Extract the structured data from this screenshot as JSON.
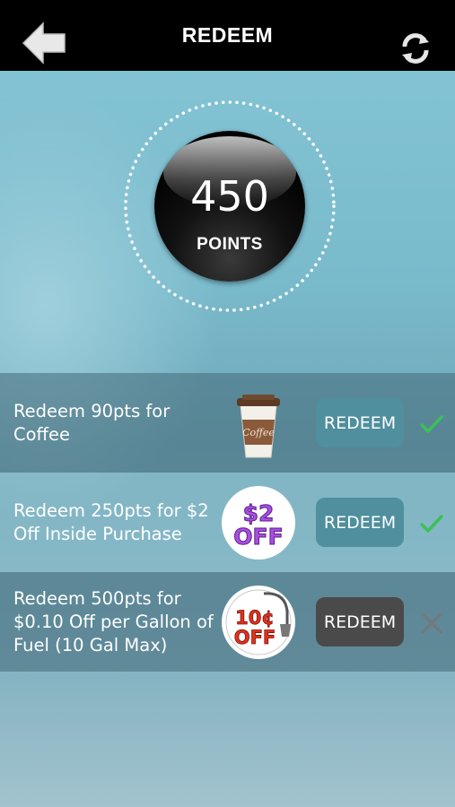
{
  "header": {
    "title": "REDEEM"
  },
  "points": {
    "value": "450",
    "label": "POINTS"
  },
  "rewards": [
    {
      "text": "Redeem 90pts for Coffee",
      "image": "coffee-cup",
      "button_label": "REDEEM",
      "status": "available"
    },
    {
      "text": "Redeem 250pts for $2 Off Inside Purchase",
      "image": "two-dollar-off-badge",
      "badge_line1": "$2",
      "badge_line2": "OFF",
      "button_label": "REDEEM",
      "status": "available"
    },
    {
      "text": "Redeem 500pts for $0.10 Off per Gallon of Fuel (10 Gal Max)",
      "image": "ten-cent-off-fuel-badge",
      "badge_line1": "10¢",
      "badge_line2": "OFF",
      "button_label": "REDEEM",
      "status": "unavailable"
    }
  ],
  "colors": {
    "topbar": "#000000",
    "button_enabled": "#4f8f9e",
    "button_disabled": "#4a4a4a",
    "check": "#3bbf5a",
    "cross": "#777777",
    "badge_purple": "#a64fe0",
    "badge_red": "#e0321e"
  }
}
